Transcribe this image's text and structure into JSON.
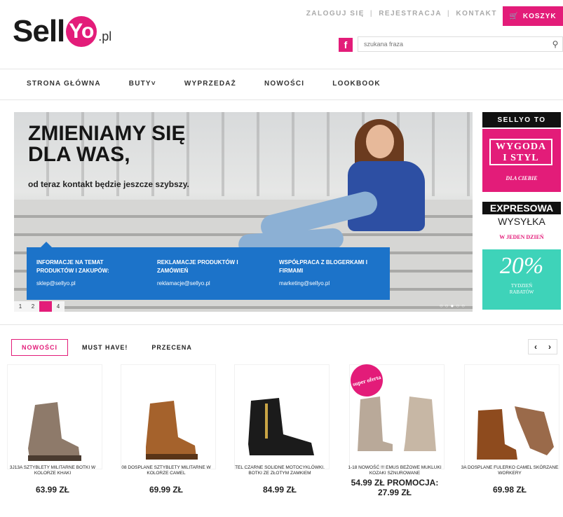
{
  "header": {
    "logo": {
      "sell": "Sell",
      "yo": "Yo",
      "pl": ".pl"
    },
    "links": [
      "ZALOGUJ SIĘ",
      "REJESTRACJA",
      "KONTAKT"
    ],
    "cart_label": "KOSZYK",
    "search_placeholder": "szukana fraza",
    "facebook_icon": "f"
  },
  "nav": [
    "STRONA GŁÓWNA",
    "BUTY˅",
    "WYPRZEDAŻ",
    "NOWOŚCI",
    "LOOKBOOK"
  ],
  "hero": {
    "headline": "ZMIENIAMY SIĘ DLA WAS,",
    "subline": "od teraz kontakt będzie jeszcze szybszy.",
    "info": [
      {
        "title": "INFORMACJE NA TEMAT PRODUKTÓW I ZAKUPÓW:",
        "mail": "sklep@sellyo.pl"
      },
      {
        "title": "REKLAMACJE PRODUKTÓW I ZAMÓWIEŃ",
        "mail": "reklamacje@sellyo.pl"
      },
      {
        "title": "WSPÓŁPRACA Z BLOGERKAMI I FIRMAMI",
        "mail": "marketing@sellyo.pl"
      }
    ],
    "pager": [
      "1",
      "2",
      "3",
      "4"
    ],
    "active_page": "3"
  },
  "side": {
    "title": "SELLYO TO",
    "promo1_line1": "WYGODA",
    "promo1_line2": "I STYL",
    "promo1_small": "DLA CIEBIE",
    "promo2_line1": "EXPRESOWA",
    "promo2_line2": "WYSYŁKA",
    "promo2_small": "W JEDEN DZIEŃ",
    "promo3_big": "20%",
    "promo3_small1": "TYDZIEŃ",
    "promo3_small2": "RABATÓW"
  },
  "tabs": [
    "NOWOŚCI",
    "MUST HAVE!",
    "PRZECENA"
  ],
  "arrows": {
    "prev": "‹",
    "next": "›"
  },
  "badge": "super oferta",
  "products": [
    {
      "name": "3J13A SZTYBLETY MILITARNE BOTKI W KOLORZE KHAKI",
      "price": "63.99 ZŁ",
      "color": "#8e7a6a"
    },
    {
      "name": "08 DOSPLANE SZTYBLETY MILITARNE W KOLORZE CAMEL",
      "price": "69.99 ZŁ",
      "color": "#a5622c"
    },
    {
      "name": "TEL CZARNE SOLIDNE MOTOCYKLÓWKI. BOTKI ZE ZŁOTYM ZAMKIEM",
      "price": "84.99 ZŁ",
      "color": "#1b1b1b"
    },
    {
      "name": "1-18 NOWOŚĆ !!! EMUS BEŻOWE MUKLUKI KOZAKI SZNUROWANE",
      "price_old": "54.99 ZŁ PROMOCJA:",
      "price": "27.99 ZŁ",
      "color": "#b9a999"
    },
    {
      "name": "3A DOSPLANE fulerko CAMEL SKÓRZANE WORKERY",
      "price": "69.98 ZŁ",
      "color": "#8e4b1e"
    }
  ]
}
